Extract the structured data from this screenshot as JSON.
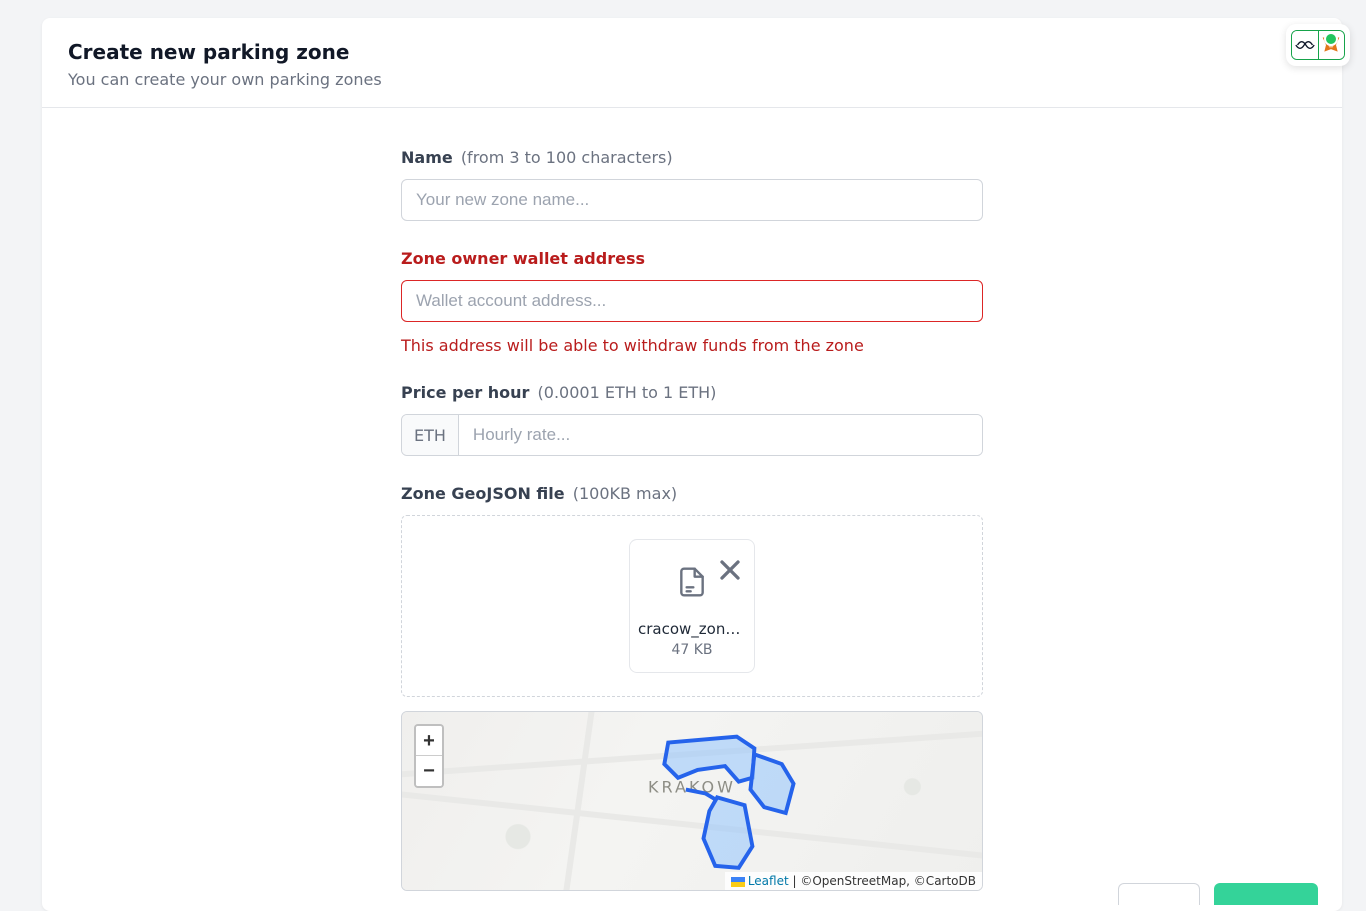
{
  "header": {
    "title": "Create new parking zone",
    "subtitle": "You can create your own parking zones"
  },
  "name_field": {
    "label": "Name",
    "hint": "(from 3 to 100 characters)",
    "placeholder": "Your new zone name...",
    "value": ""
  },
  "wallet_field": {
    "label": "Zone owner wallet address",
    "placeholder": "Wallet account address...",
    "value": "",
    "help": "This address will be able to withdraw funds from the zone"
  },
  "price_field": {
    "label": "Price per hour",
    "hint": "(0.0001 ETH to 1 ETH)",
    "addon": "ETH",
    "placeholder": "Hourly rate...",
    "value": ""
  },
  "geojson_field": {
    "label": "Zone GeoJSON file",
    "hint": "(100KB max)",
    "file": {
      "name": "cracow_zone…",
      "size": "47 KB"
    }
  },
  "map": {
    "city_label": "KRAKOW",
    "zoom_in": "+",
    "zoom_out": "−",
    "attribution": {
      "leaflet_text": "Leaflet",
      "rest": " | ©OpenStreetMap, ©CartoDB"
    }
  }
}
